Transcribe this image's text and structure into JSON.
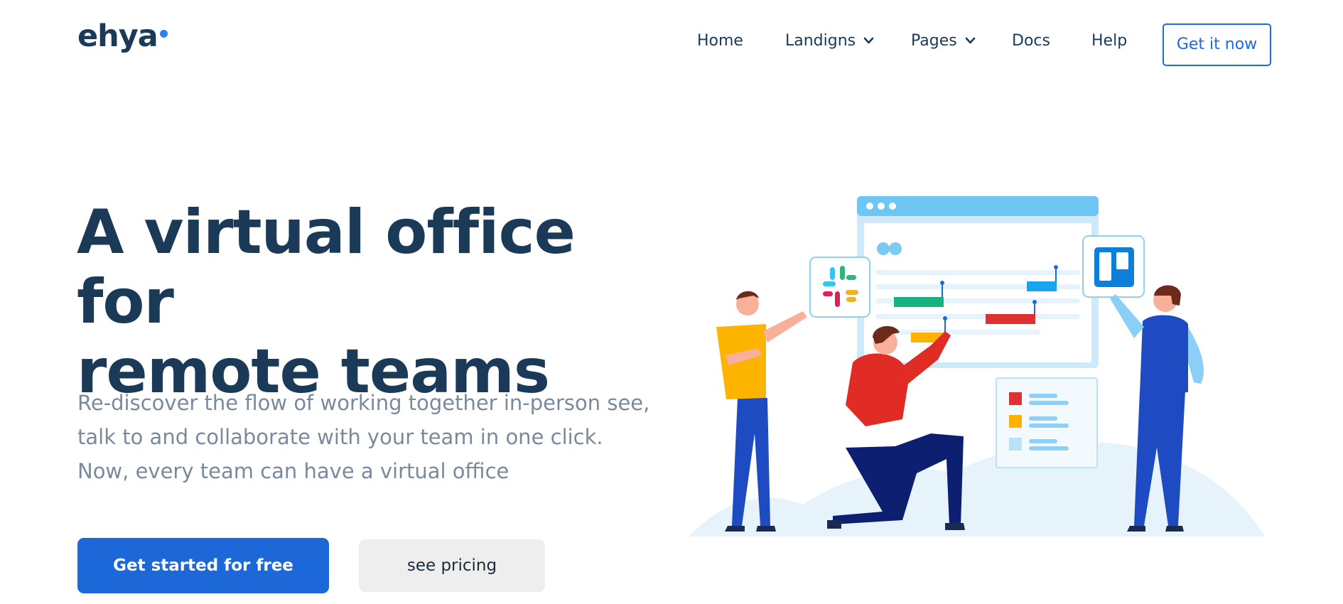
{
  "brand": {
    "logo_text": "ehya",
    "accent": "#2f80ed"
  },
  "nav": {
    "items": [
      {
        "label": "Home",
        "has_dropdown": false
      },
      {
        "label": "Landigns",
        "has_dropdown": true,
        "icon": "chevron-down-icon"
      },
      {
        "label": "Pages",
        "has_dropdown": true,
        "icon": "chevron-down-icon"
      },
      {
        "label": "Docs",
        "has_dropdown": false
      },
      {
        "label": "Help",
        "has_dropdown": false
      }
    ],
    "cta_label": "Get it now"
  },
  "hero": {
    "headline_line1": "A virtual office for",
    "headline_line2": "remote teams",
    "sub_line1": "Re-discover the flow of working together in-person see,",
    "sub_line2": "talk to and collaborate with your team in one click.",
    "sub_line3": "Now, every team can have a virtual office",
    "primary_cta": "Get started for free",
    "secondary_cta": "see pricing"
  },
  "colors": {
    "heading": "#1b3a57",
    "body_text": "#7a8a9c",
    "primary": "#1c68d8",
    "secondary_bg": "#eeeeee"
  }
}
